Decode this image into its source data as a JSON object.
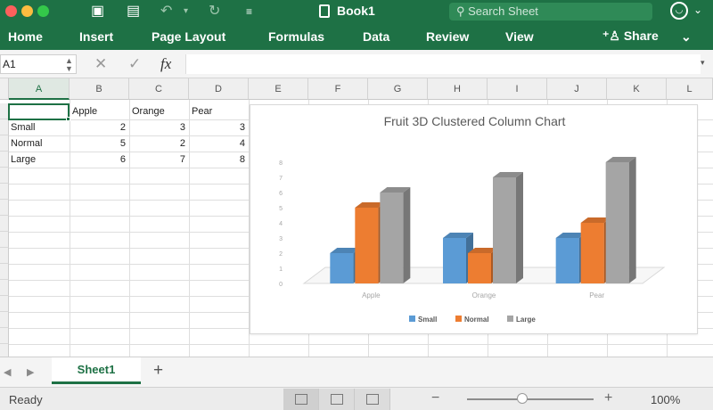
{
  "window": {
    "title": "Book1",
    "search_placeholder": "Search Sheet"
  },
  "ribbon": {
    "tabs": [
      "Home",
      "Insert",
      "Page Layout",
      "Formulas",
      "Data",
      "Review",
      "View"
    ],
    "share_label": "Share"
  },
  "formula_bar": {
    "name_box": "A1",
    "cancel_glyph": "✕",
    "enter_glyph": "✓",
    "fx_glyph": "fx",
    "formula": ""
  },
  "sheet": {
    "columns": [
      "A",
      "B",
      "C",
      "D",
      "E",
      "F",
      "G",
      "H",
      "I",
      "J",
      "K",
      "L"
    ],
    "selected_column": "A",
    "headers": [
      "Apple",
      "Orange",
      "Pear"
    ],
    "rows": [
      {
        "label": "Small",
        "values": [
          "2",
          "3",
          "3"
        ]
      },
      {
        "label": "Normal",
        "values": [
          "5",
          "2",
          "4"
        ]
      },
      {
        "label": "Large",
        "values": [
          "6",
          "7",
          "8"
        ]
      }
    ]
  },
  "chart_data": {
    "type": "bar",
    "variant": "3d-clustered-column",
    "title": "Fruit 3D Clustered Column Chart",
    "categories": [
      "Apple",
      "Orange",
      "Pear"
    ],
    "series": [
      {
        "name": "Small",
        "values": [
          2,
          3,
          3
        ],
        "color": "#5b9bd5"
      },
      {
        "name": "Normal",
        "values": [
          5,
          2,
          4
        ],
        "color": "#ed7d31"
      },
      {
        "name": "Large",
        "values": [
          6,
          7,
          8
        ],
        "color": "#a5a5a5"
      }
    ],
    "ylim": [
      0,
      8
    ],
    "yticks": [
      "0",
      "1",
      "2",
      "3",
      "4",
      "5",
      "6",
      "7",
      "8"
    ],
    "legend_position": "bottom",
    "grid": false
  },
  "sheet_tabs": {
    "active": "Sheet1",
    "add_glyph": "+"
  },
  "status": {
    "text": "Ready",
    "zoom_minus": "−",
    "zoom_plus": "+",
    "zoom_level": "100%",
    "zoom_slider_fraction": 0.5
  },
  "colors": {
    "brand_green": "#1e7145"
  }
}
